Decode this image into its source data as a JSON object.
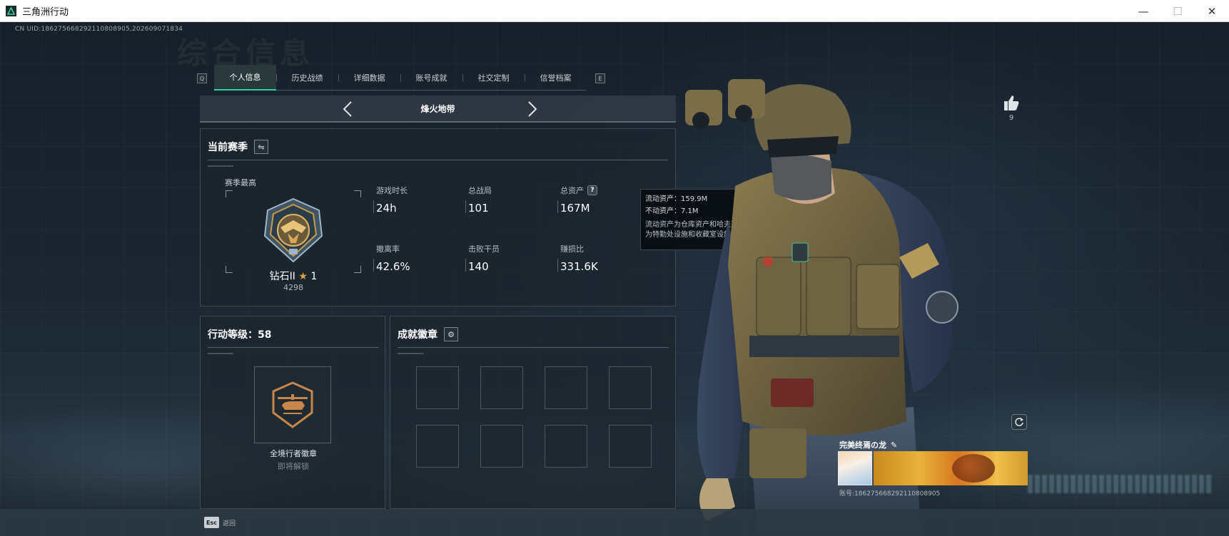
{
  "window": {
    "title": "三角洲行动",
    "minimize": "—",
    "maximize": "☐",
    "close": "✕"
  },
  "uid_line": "CN UID:18627566829211080890​5,202609071834",
  "watermark": "综合信息",
  "tabs": {
    "left_key": "Q",
    "right_key": "E",
    "items": [
      {
        "label": "个人信息",
        "active": true
      },
      {
        "label": "历史战绩",
        "active": false
      },
      {
        "label": "详细数据",
        "active": false
      },
      {
        "label": "账号成就",
        "active": false
      },
      {
        "label": "社交定制",
        "active": false
      },
      {
        "label": "信誉档案",
        "active": false
      }
    ]
  },
  "mode": {
    "title": "烽火地带"
  },
  "season": {
    "title": "当前赛季",
    "switch_icon": "⇋",
    "best_label": "赛季最高",
    "rank_name": "钻石II",
    "rank_stars": "1",
    "rank_score": "4298",
    "stats": [
      {
        "label": "游戏时长",
        "value": "24h"
      },
      {
        "label": "总战局",
        "value": "101"
      },
      {
        "label": "总资产",
        "value": "167M",
        "help": "?"
      },
      {
        "label": "撤离率",
        "value": "42.6%"
      },
      {
        "label": "击败干员",
        "value": "140"
      },
      {
        "label": "赚损比",
        "value": "331.6K"
      }
    ]
  },
  "tooltip": {
    "liquid": "流动资产：159.9M",
    "fixed": "不动资产：7.1M",
    "note_line1": "流动资产为仓库资产和哈夫币，不动资产",
    "note_line2": "为特勤处设施和收藏室设施"
  },
  "level": {
    "title": "行动等级：58",
    "badge_name": "全境行者徽章",
    "badge_status": "即将解锁"
  },
  "achievements": {
    "title": "成就徽章",
    "gear_icon": "⚙",
    "slots": 8
  },
  "likes": {
    "count": "9"
  },
  "card": {
    "name": "完美终焉の龙",
    "edit_icon": "✎",
    "account": "账号:186275668292110808905"
  },
  "footer": {
    "esc_key": "Esc",
    "esc_label": "返回"
  },
  "colors": {
    "accent": "#2fd3a2",
    "rank_gold": "#d9a73e",
    "panel_bg": "#1c262e",
    "tooltip_bg": "#0a0e12"
  }
}
